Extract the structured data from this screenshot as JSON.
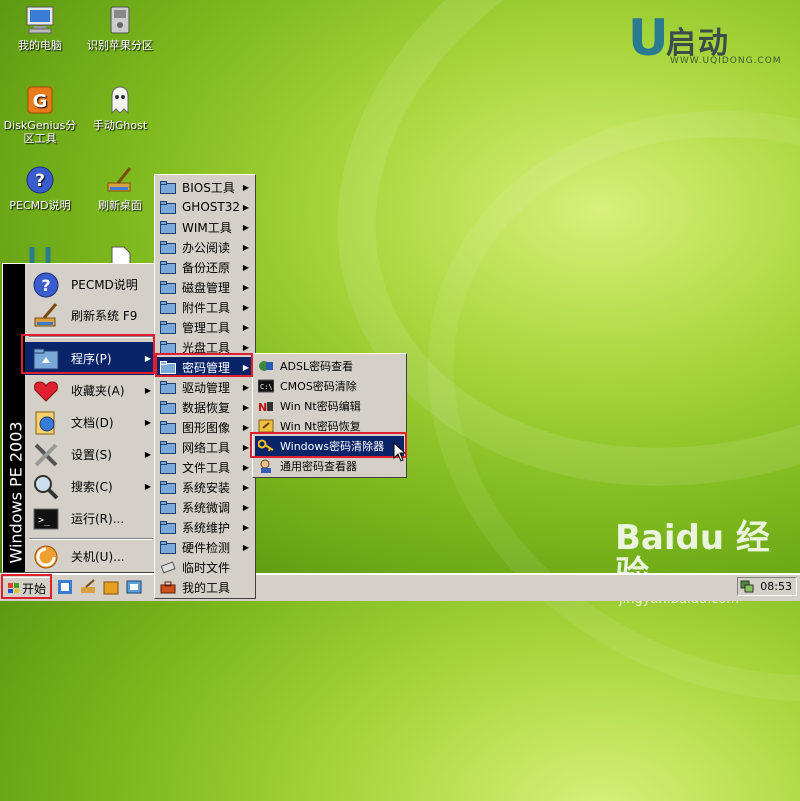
{
  "desktop": {
    "icons": [
      {
        "label": "我的电脑",
        "icon": "computer-icon"
      },
      {
        "label": "识别苹果分区",
        "icon": "drive-icon"
      },
      {
        "label": "DiskGenius分区工具",
        "label_line1": "DiskGenius分",
        "label_line2": "区工具",
        "icon": "diskgenius-icon"
      },
      {
        "label": "手动Ghost",
        "icon": "ghost-icon"
      },
      {
        "label": "PECMD说明",
        "icon": "help-icon"
      },
      {
        "label": "刷新桌面",
        "icon": "refresh-broom-icon"
      }
    ],
    "logo": {
      "brand": "U",
      "text": "启动",
      "url": "WWW.UQIDONG.COM"
    },
    "watermark": {
      "brand": "Baidu 经验",
      "url": "jingyan.baidu.com"
    }
  },
  "start_menu": {
    "sidebar_text": "Windows PE 2003",
    "items": [
      {
        "label": "PECMD说明",
        "icon": "help-icon",
        "submenu": false
      },
      {
        "label": "刷新系统 F9",
        "icon": "refresh-broom-icon",
        "submenu": false
      },
      {
        "label": "程序(P)",
        "icon": "programs-folder-icon",
        "submenu": true,
        "selected": true
      },
      {
        "label": "收藏夹(A)",
        "icon": "heart-icon",
        "submenu": true
      },
      {
        "label": "文档(D)",
        "icon": "documents-icon",
        "submenu": true
      },
      {
        "label": "设置(S)",
        "icon": "settings-tools-icon",
        "submenu": true
      },
      {
        "label": "搜索(C)",
        "icon": "search-icon",
        "submenu": true
      },
      {
        "label": "运行(R)...",
        "icon": "run-icon",
        "submenu": false
      },
      {
        "label": "关机(U)...",
        "icon": "shutdown-icon",
        "submenu": false
      }
    ]
  },
  "programs_menu": {
    "items": [
      {
        "label": "BIOS工具",
        "submenu": true
      },
      {
        "label": "GHOST32",
        "submenu": true
      },
      {
        "label": "WIM工具",
        "submenu": true
      },
      {
        "label": "办公阅读",
        "submenu": true
      },
      {
        "label": "备份还原",
        "submenu": true
      },
      {
        "label": "磁盘管理",
        "submenu": true
      },
      {
        "label": "附件工具",
        "submenu": true
      },
      {
        "label": "管理工具",
        "submenu": true
      },
      {
        "label": "光盘工具",
        "submenu": true
      },
      {
        "label": "密码管理",
        "submenu": true,
        "selected": true
      },
      {
        "label": "驱动管理",
        "submenu": true
      },
      {
        "label": "数据恢复",
        "submenu": true
      },
      {
        "label": "图形图像",
        "submenu": true
      },
      {
        "label": "网络工具",
        "submenu": true
      },
      {
        "label": "文件工具",
        "submenu": true
      },
      {
        "label": "系统安装",
        "submenu": true
      },
      {
        "label": "系统微调",
        "submenu": true
      },
      {
        "label": "系统维护",
        "submenu": true
      },
      {
        "label": "硬件检测",
        "submenu": true
      },
      {
        "label": "临时文件",
        "submenu": false
      },
      {
        "label": "我的工具",
        "submenu": false
      }
    ]
  },
  "password_menu": {
    "items": [
      {
        "label": "ADSL密码查看",
        "icon": "adsl-icon"
      },
      {
        "label": "CMOS密码清除",
        "icon": "console-icon"
      },
      {
        "label": "Win Nt密码编辑",
        "icon": "nt-edit-icon"
      },
      {
        "label": "Win Nt密码恢复",
        "icon": "nt-recover-icon"
      },
      {
        "label": "Windows密码清除器",
        "icon": "key-icon",
        "selected": true
      },
      {
        "label": "通用密码查看器",
        "icon": "password-viewer-icon"
      }
    ]
  },
  "taskbar": {
    "start_label": "开始",
    "clock": "08:53"
  },
  "colors": {
    "highlight": "#0a246a",
    "annotation_red": "#e11e2d",
    "menu_bg": "#d4d0c8"
  }
}
